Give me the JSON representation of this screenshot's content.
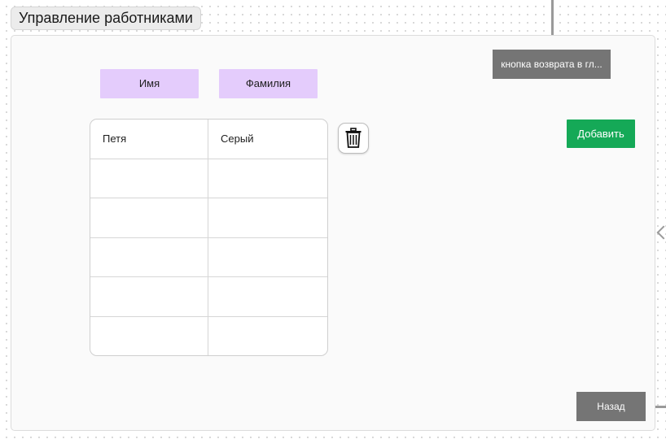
{
  "frame": {
    "title": "Управление работниками"
  },
  "columns": {
    "first_name": "Имя",
    "last_name": "Фамилия"
  },
  "table": {
    "rows": [
      [
        "Петя",
        "Серый"
      ],
      [
        "",
        ""
      ],
      [
        "",
        ""
      ],
      [
        "",
        ""
      ],
      [
        "",
        ""
      ],
      [
        "",
        ""
      ]
    ]
  },
  "buttons": {
    "back_home": "кнопка возврата в гл...",
    "add": "Добавить",
    "back": "Назад",
    "delete_icon": "trash-icon"
  },
  "colors": {
    "header_chip": "#e4ccfc",
    "add_button": "#15a957",
    "gray_button": "#757575"
  }
}
